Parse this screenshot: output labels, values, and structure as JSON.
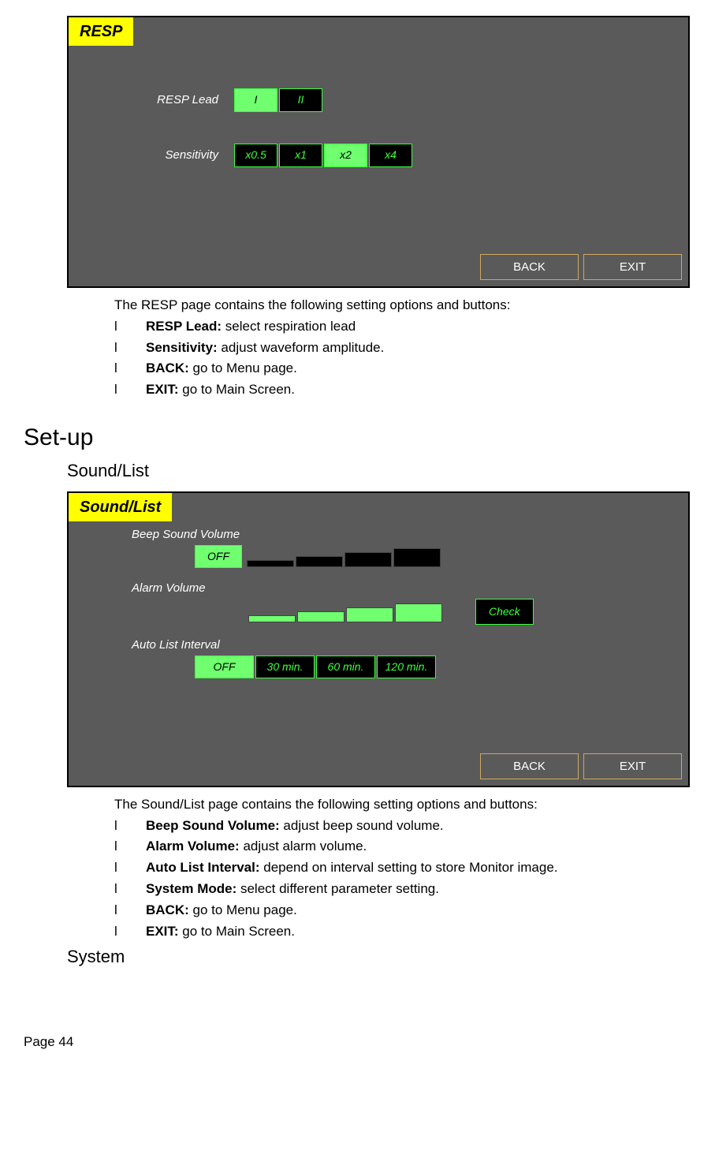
{
  "resp": {
    "title": "RESP",
    "rows": {
      "lead_label": "RESP Lead",
      "lead_options": [
        "I",
        "II"
      ],
      "lead_selected": 0,
      "sens_label": "Sensitivity",
      "sens_options": [
        "x0.5",
        "x1",
        "x2",
        "x4"
      ],
      "sens_selected": 2
    },
    "nav": {
      "back": "BACK",
      "exit": "EXIT"
    }
  },
  "resp_desc": {
    "intro": "The RESP page contains the following setting options and buttons:",
    "items": [
      {
        "bold": "RESP Lead:",
        "rest": " select respiration lead"
      },
      {
        "bold": "Sensitivity:",
        "rest": " adjust waveform amplitude."
      },
      {
        "bold": "BACK:",
        "rest": " go to Menu page."
      },
      {
        "bold": "EXIT:",
        "rest": " go to Main Screen."
      }
    ]
  },
  "setup_heading": "Set-up",
  "sound_heading": "Sound/List",
  "sound": {
    "title": "Sound/List",
    "labels": {
      "beep": "Beep Sound Volume",
      "alarm": "Alarm Volume",
      "interval": "Auto List Interval"
    },
    "beep_off": "OFF",
    "check": "Check",
    "interval_off": "OFF",
    "interval_options": [
      "30 min.",
      "60 min.",
      "120 min."
    ],
    "nav": {
      "back": "BACK",
      "exit": "EXIT"
    }
  },
  "sound_desc": {
    "intro": "The Sound/List page contains the following setting options and buttons:",
    "items": [
      {
        "bold": "Beep Sound Volume:",
        "rest": " adjust beep sound volume."
      },
      {
        "bold": "Alarm Volume:",
        "rest": " adjust alarm volume."
      },
      {
        "bold": "Auto List Interval:",
        "rest": " depend on interval setting to store Monitor image."
      },
      {
        "bold": "System Mode:",
        "rest": " select different parameter setting."
      },
      {
        "bold": "BACK:",
        "rest": " go to Menu page."
      },
      {
        "bold": "EXIT:",
        "rest": " go to Main Screen."
      }
    ]
  },
  "system_heading": "System",
  "page_number": "Page 44",
  "bullet": "l"
}
